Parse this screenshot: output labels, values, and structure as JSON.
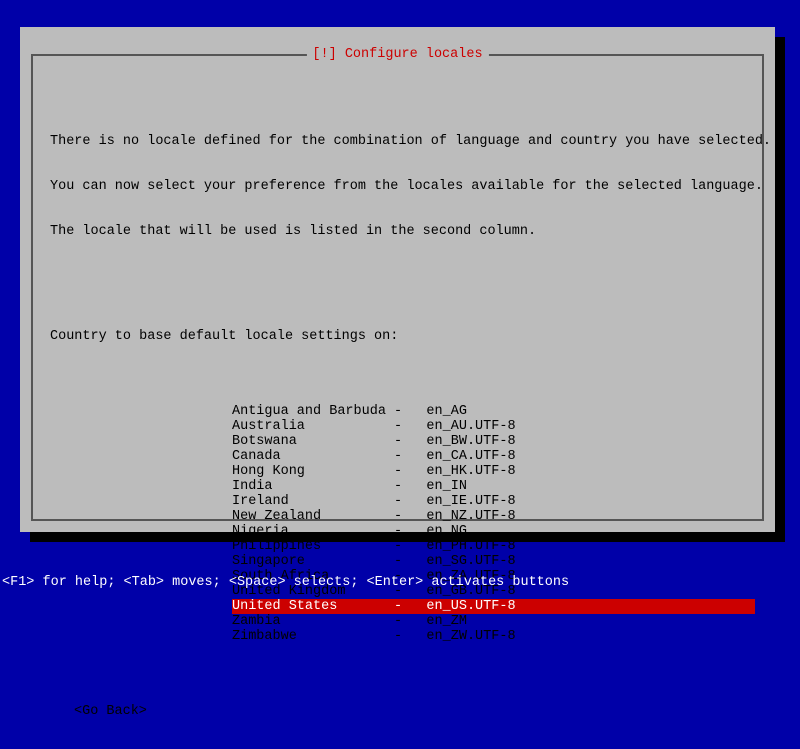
{
  "dialog": {
    "title": "[!] Configure locales",
    "description_line1": "There is no locale defined for the combination of language and country you have selected.",
    "description_line2": "You can now select your preference from the locales available for the selected language.",
    "description_line3": "The locale that will be used is listed in the second column.",
    "prompt": "Country to base default locale settings on:",
    "items": [
      {
        "country": "Antigua and Barbuda",
        "locale": "en_AG",
        "selected": false
      },
      {
        "country": "Australia",
        "locale": "en_AU.UTF-8",
        "selected": false
      },
      {
        "country": "Botswana",
        "locale": "en_BW.UTF-8",
        "selected": false
      },
      {
        "country": "Canada",
        "locale": "en_CA.UTF-8",
        "selected": false
      },
      {
        "country": "Hong Kong",
        "locale": "en_HK.UTF-8",
        "selected": false
      },
      {
        "country": "India",
        "locale": "en_IN",
        "selected": false
      },
      {
        "country": "Ireland",
        "locale": "en_IE.UTF-8",
        "selected": false
      },
      {
        "country": "New Zealand",
        "locale": "en_NZ.UTF-8",
        "selected": false
      },
      {
        "country": "Nigeria",
        "locale": "en_NG",
        "selected": false
      },
      {
        "country": "Philippines",
        "locale": "en_PH.UTF-8",
        "selected": false
      },
      {
        "country": "Singapore",
        "locale": "en_SG.UTF-8",
        "selected": false
      },
      {
        "country": "South Africa",
        "locale": "en_ZA.UTF-8",
        "selected": false
      },
      {
        "country": "United Kingdom",
        "locale": "en_GB.UTF-8",
        "selected": false
      },
      {
        "country": "United States",
        "locale": "en_US.UTF-8",
        "selected": true
      },
      {
        "country": "Zambia",
        "locale": "en_ZM",
        "selected": false
      },
      {
        "country": "Zimbabwe",
        "locale": "en_ZW.UTF-8",
        "selected": false
      }
    ],
    "go_back": "<Go Back>",
    "country_col_width": 20,
    "separator": "-",
    "locale_pad": 3
  },
  "footer": "<F1> for help; <Tab> moves; <Space> selects; <Enter> activates buttons"
}
